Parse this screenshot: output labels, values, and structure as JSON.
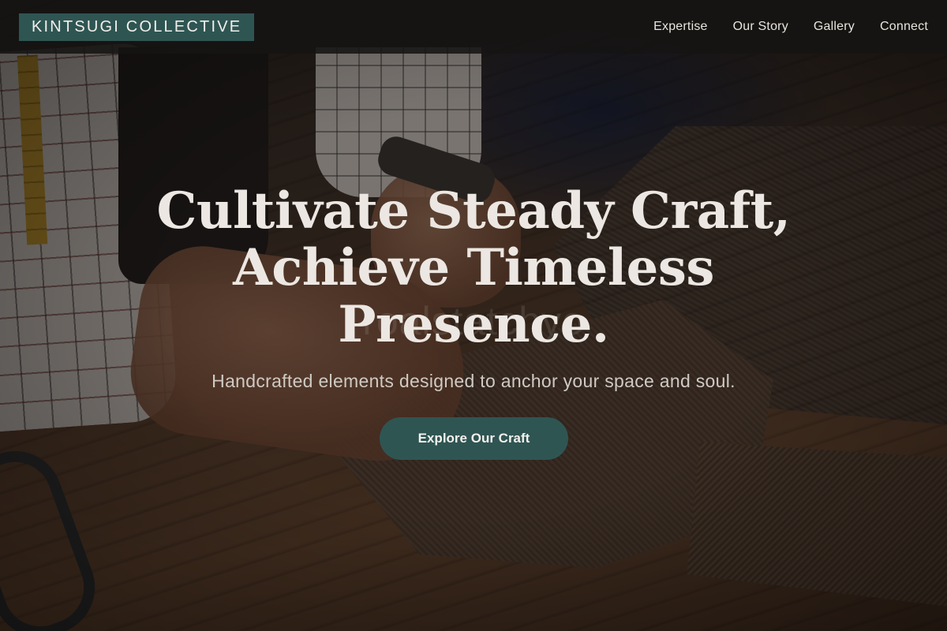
{
  "header": {
    "brand": "KINTSUGI COLLECTIVE",
    "nav": [
      {
        "label": "Expertise"
      },
      {
        "label": "Our Story"
      },
      {
        "label": "Gallery"
      },
      {
        "label": "Connect"
      }
    ]
  },
  "hero": {
    "headline_line1": "Cultivate Steady Craft,",
    "headline_line2": "Achieve Timeless",
    "headline_line3": "Presence.",
    "subheadline": "Handcrafted elements designed to anchor your space and soul.",
    "cta_label": "Explore Our Craft",
    "watermark": "roalstatchyo"
  },
  "colors": {
    "accent": "#2f5553",
    "header_bg": "#161413",
    "heading_text": "#ece7e2"
  },
  "background_image": "tailor-hands-cutting-tweed-fabric-on-wooden-table"
}
